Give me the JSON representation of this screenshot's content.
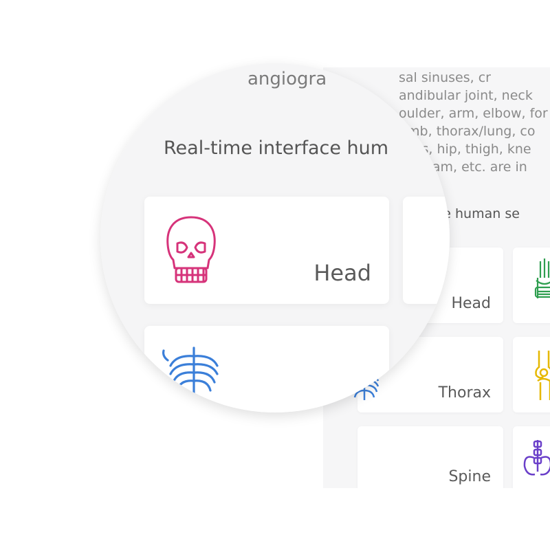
{
  "background": {
    "description_lines": [
      "sal sinuses, cr",
      "andibular joint, neck",
      "oulder, arm, elbow, for",
      "umb, thorax/lung, co",
      "elvis, hip, thigh, kne",
      "giogram, etc. are in"
    ],
    "subtitle": "erface human se",
    "cards": [
      {
        "label": "Head",
        "icon": "skull-icon"
      },
      {
        "label": "",
        "icon": "hand-icon"
      },
      {
        "label": "Thorax",
        "icon": "ribcage-icon"
      },
      {
        "label": "",
        "icon": "knee-icon"
      },
      {
        "label": "Spine",
        "icon": "spine-icon"
      },
      {
        "label": "",
        "icon": "pelvis-icon"
      }
    ]
  },
  "magnifier": {
    "top_text": "angiogra",
    "title": "Real-time interface hum",
    "cards": [
      {
        "label": "Head",
        "icon": "skull-icon"
      },
      {
        "label": "",
        "icon": "ribcage-icon"
      }
    ]
  },
  "colors": {
    "skull": "#d6337a",
    "ribcage": "#3b7fd9",
    "hand": "#2e9e4f",
    "knee": "#e6b800",
    "pelvis": "#6a3fc9"
  }
}
